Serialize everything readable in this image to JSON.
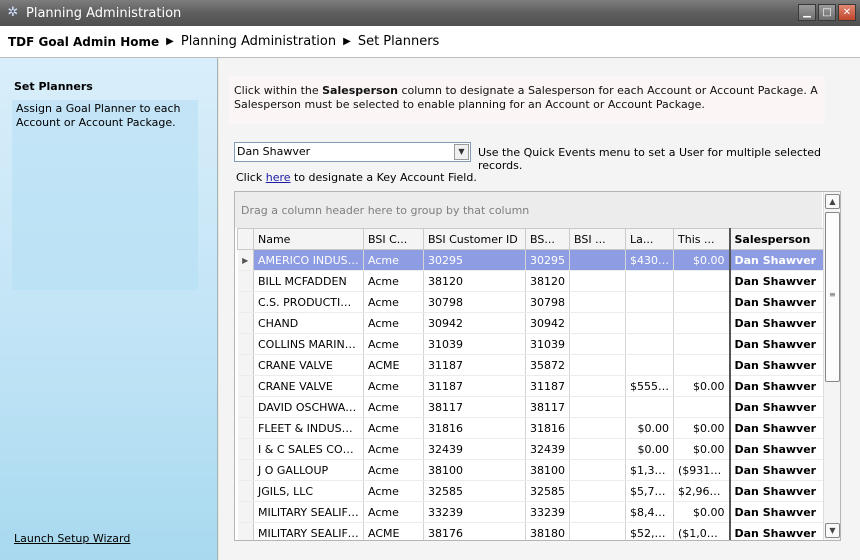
{
  "window": {
    "title": "Planning Administration",
    "icon": "gear-icon"
  },
  "breadcrumb": {
    "home": "TDF Goal Admin Home",
    "level1": "Planning Administration",
    "level2": "Set Planners"
  },
  "left": {
    "title": "Set Planners",
    "description": "Assign a Goal Planner to each Account or Account Package.",
    "wizard_link": "Launch Setup Wizard"
  },
  "instructions": {
    "part1": "Click within the ",
    "bold": "Salesperson",
    "part2": " column to designate a Salesperson for each Account or Account Package.  A Salesperson must be selected to enable planning for an Account or Account Package."
  },
  "user_select": {
    "value": "Dan Shawver"
  },
  "quick_events_text": "Use the Quick Events menu to set a User for multiple selected records.",
  "key_account": {
    "prefix": "Click ",
    "link": "here",
    "suffix": " to designate a Key Account Field."
  },
  "grid": {
    "group_hint": "Drag a column header here to group by that column",
    "columns": [
      "Name",
      "BSI C...",
      "BSI Customer ID",
      "BS...",
      "BSI ...",
      "La...",
      "This ...",
      "Salesperson"
    ],
    "rows": [
      [
        "AMERICO INDUST...",
        "Acme",
        "30295",
        "30295",
        "",
        "$430.00",
        "$0.00",
        "Dan Shawver"
      ],
      [
        "BILL MCFADDEN",
        "Acme",
        "38120",
        "38120",
        "",
        "",
        "",
        "Dan Shawver"
      ],
      [
        "C.S. PRODUCTIONS",
        "Acme",
        "30798",
        "30798",
        "",
        "",
        "",
        "Dan Shawver"
      ],
      [
        "CHAND",
        "Acme",
        "30942",
        "30942",
        "",
        "",
        "",
        "Dan Shawver"
      ],
      [
        "COLLINS MARINE ...",
        "Acme",
        "31039",
        "31039",
        "",
        "",
        "",
        "Dan Shawver"
      ],
      [
        "CRANE VALVE",
        "ACME",
        "31187",
        "35872",
        "",
        "",
        "",
        "Dan Shawver"
      ],
      [
        "CRANE VALVE",
        "Acme",
        "31187",
        "31187",
        "",
        "$555.56",
        "$0.00",
        "Dan Shawver"
      ],
      [
        "DAVID OSCHWALD",
        "Acme",
        "38117",
        "38117",
        "",
        "",
        "",
        "Dan Shawver"
      ],
      [
        "FLEET & INDUSTRI...",
        "Acme",
        "31816",
        "31816",
        "",
        "$0.00",
        "$0.00",
        "Dan Shawver"
      ],
      [
        "I & C SALES CORP...",
        "Acme",
        "32439",
        "32439",
        "",
        "$0.00",
        "$0.00",
        "Dan Shawver"
      ],
      [
        "J O GALLOUP",
        "Acme",
        "38100",
        "38100",
        "",
        "$1,33...",
        "($931.00)",
        "Dan Shawver"
      ],
      [
        "JGILS, LLC",
        "Acme",
        "32585",
        "32585",
        "",
        "$5,75...",
        "$2,960.00",
        "Dan Shawver"
      ],
      [
        "MILITARY SEALIFT...",
        "Acme",
        "33239",
        "33239",
        "",
        "$8,43...",
        "$0.00",
        "Dan Shawver"
      ],
      [
        "MILITARY SEALIFT...",
        "ACME",
        "38176",
        "38180",
        "",
        "$52,0...",
        "($1,050...",
        "Dan Shawver"
      ]
    ],
    "selected_row": 0
  },
  "colors": {
    "selection": "#8e9de3",
    "left_panel": "#bfe3f5"
  }
}
